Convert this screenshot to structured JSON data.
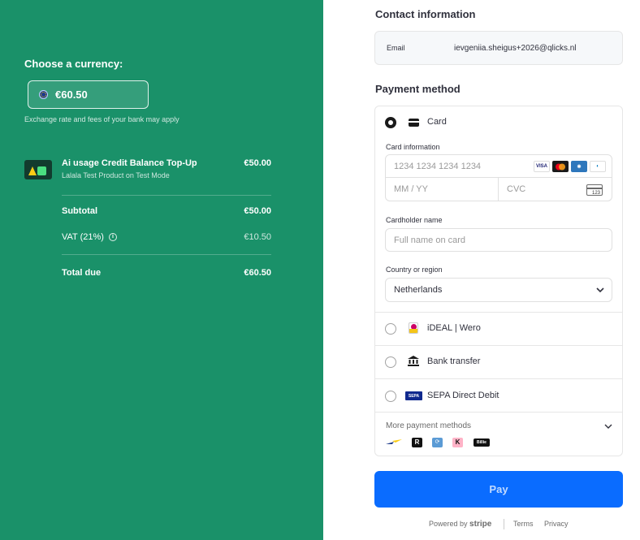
{
  "summary": {
    "choose_currency": "Choose a currency:",
    "currency_amount": "€60.50",
    "rate_note": "Exchange rate and fees of your bank may apply",
    "item": {
      "title": "Ai usage Credit Balance Top-Up",
      "subtitle": "Lalala Test Product on Test Mode",
      "price": "€50.00"
    },
    "subtotal_label": "Subtotal",
    "subtotal_value": "€50.00",
    "vat_label": "VAT (21%)",
    "vat_value": "€10.50",
    "total_label": "Total due",
    "total_value": "€60.50"
  },
  "contact": {
    "heading": "Contact information",
    "email_label": "Email",
    "email_value": "ievgeniia.sheigus+2026@qlicks.nl"
  },
  "payment": {
    "heading": "Payment method",
    "card_label": "Card",
    "card_info_label": "Card information",
    "card_number_placeholder": "1234 1234 1234 1234",
    "expiry_placeholder": "MM / YY",
    "cvc_placeholder": "CVC",
    "cvc_card_text": "123",
    "brands": [
      "VISA",
      "Mastercard",
      "Amex",
      "Diners"
    ],
    "cardholder_label": "Cardholder name",
    "cardholder_placeholder": "Full name on card",
    "country_label": "Country or region",
    "country_value": "Netherlands",
    "ideal_label": "iDEAL | Wero",
    "bank_label": "Bank transfer",
    "sepa_label": "SEPA Direct Debit",
    "more_label": "More payment methods",
    "more_icons": [
      "R",
      "K",
      "Billie"
    ]
  },
  "pay_button": "Pay",
  "footer": {
    "powered": "Powered by",
    "stripe": "stripe",
    "terms": "Terms",
    "privacy": "Privacy"
  },
  "colors": {
    "left_bg": "#1a9169",
    "pay_button": "#0a6cff"
  }
}
